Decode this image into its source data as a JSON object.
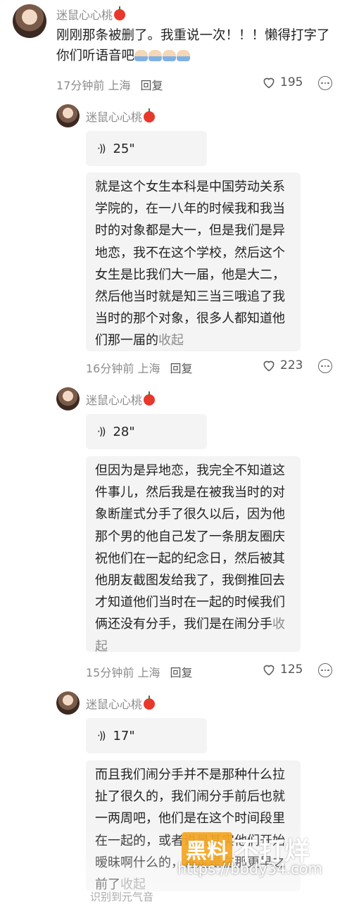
{
  "main_comment": {
    "username": "迷鼠心心桃",
    "text": "刚刚那条被删了。我重说一次！！！懒得打字了你们听语音吧",
    "time_location": "17分钟前 上海",
    "reply_label": "回复",
    "likes": "195"
  },
  "replies": [
    {
      "username": "迷鼠心心桃",
      "voice_duration": "25\"",
      "transcript": "就是这个女生本科是中国劳动关系学院的，在一八年的时候我和我当时的对象都是大一，但是我们是异地恋，我不在这个学校，然后这个女生是比我们大一届，他是大二，然后他当时就是知三当三哦追了我当时的那个对象，很多人都知道他们那一届的",
      "collapse_label": "收起",
      "time_location": "16分钟前 上海",
      "reply_label": "回复",
      "likes": "223"
    },
    {
      "username": "迷鼠心心桃",
      "voice_duration": "28\"",
      "transcript": "但因为是异地恋，我完全不知道这件事儿，然后我是在被我当时的对象断崖式分手了很久以后，因为他那个男的他自己发了一条朋友圈庆祝他们在一起的纪念日，然后被其他朋友截图发给我了，我倒推回去才知道他们当时在一起的时候我们俩还没有分手，我们是在闹分手",
      "collapse_label": "收起",
      "time_location": "15分钟前 上海",
      "reply_label": "回复",
      "likes": "125"
    },
    {
      "username": "迷鼠心心桃",
      "voice_duration": "17\"",
      "transcript": "而且我们闹分手并不是那种什么拉扯了很久的，我们闹分手前后也就一两周吧，他们是在这个时间段里在一起的，或者说是其实他们开始暧昧啊什么的，肯定是在那更早之前了",
      "collapse_label": "收起",
      "recognize_label": "识别到元气音"
    }
  ],
  "watermark": {
    "box_text": "黑料",
    "text": "不打烊",
    "url": "https://bbdy34.com"
  },
  "colors": {
    "meta_gray": "#8c8c8c",
    "bubble_bg": "#f4f4f4",
    "apple_red": "#e8382c"
  }
}
